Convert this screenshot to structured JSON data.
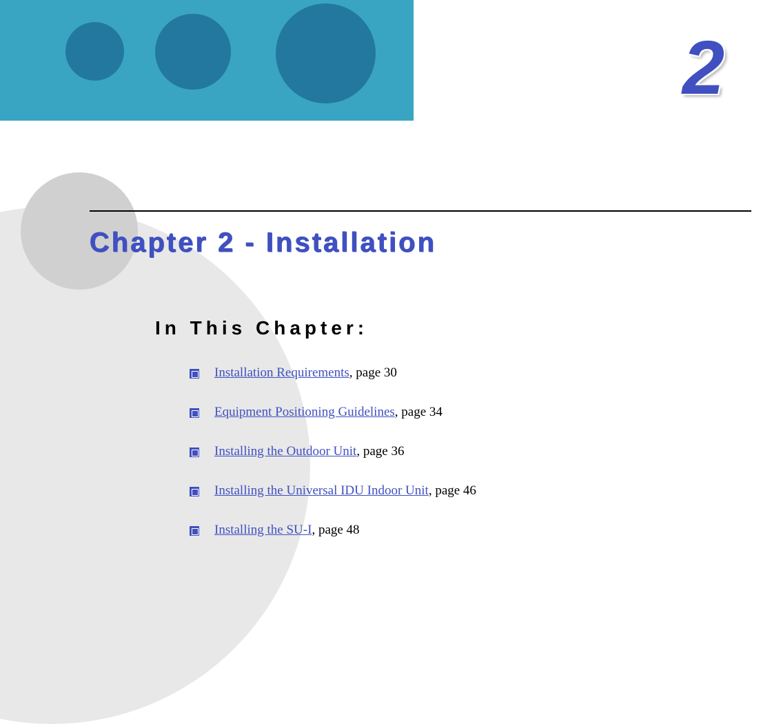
{
  "chapter_number": "2",
  "chapter_title": "Chapter 2 - Installation",
  "section_heading": "In This Chapter:",
  "toc": [
    {
      "link": "Installation Requirements",
      "page": ", page 30"
    },
    {
      "link": "Equipment Positioning Guidelines",
      "page": ", page 34"
    },
    {
      "link": "Installing the Outdoor Unit",
      "page": ", page 36"
    },
    {
      "link": "Installing the Universal IDU Indoor Unit",
      "page": ", page 46"
    },
    {
      "link": "Installing the SU-I",
      "page": ", page 48"
    }
  ]
}
